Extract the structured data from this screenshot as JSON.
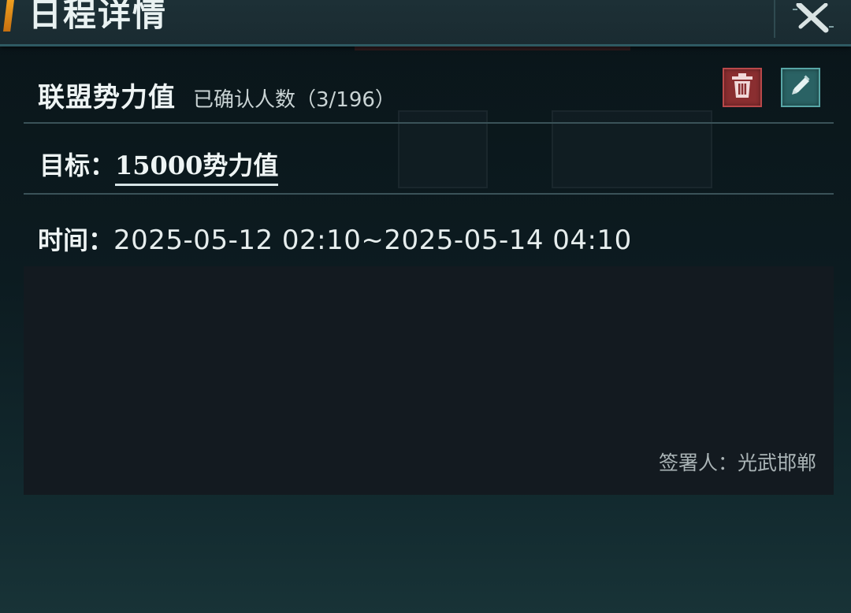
{
  "window": {
    "title": "日程详情",
    "close_icon": "close-x-icon"
  },
  "event": {
    "name": "联盟势力值",
    "confirmed_text": "已确认人数（3/196）",
    "confirmed": 3,
    "total": 196,
    "delete_icon": "trash-icon",
    "edit_icon": "pencil-icon"
  },
  "goal": {
    "label": "目标：",
    "value": "15000势力值"
  },
  "time": {
    "label": "时间：",
    "value": "2025-05-12 02:10~2025-05-14 04:10"
  },
  "description": {
    "signer": "签署人：光武邯郸"
  },
  "colors": {
    "accent": "#f0a020",
    "delete_button": "#8a2e30",
    "edit_button": "#2a6264",
    "panel": "#131a20"
  }
}
